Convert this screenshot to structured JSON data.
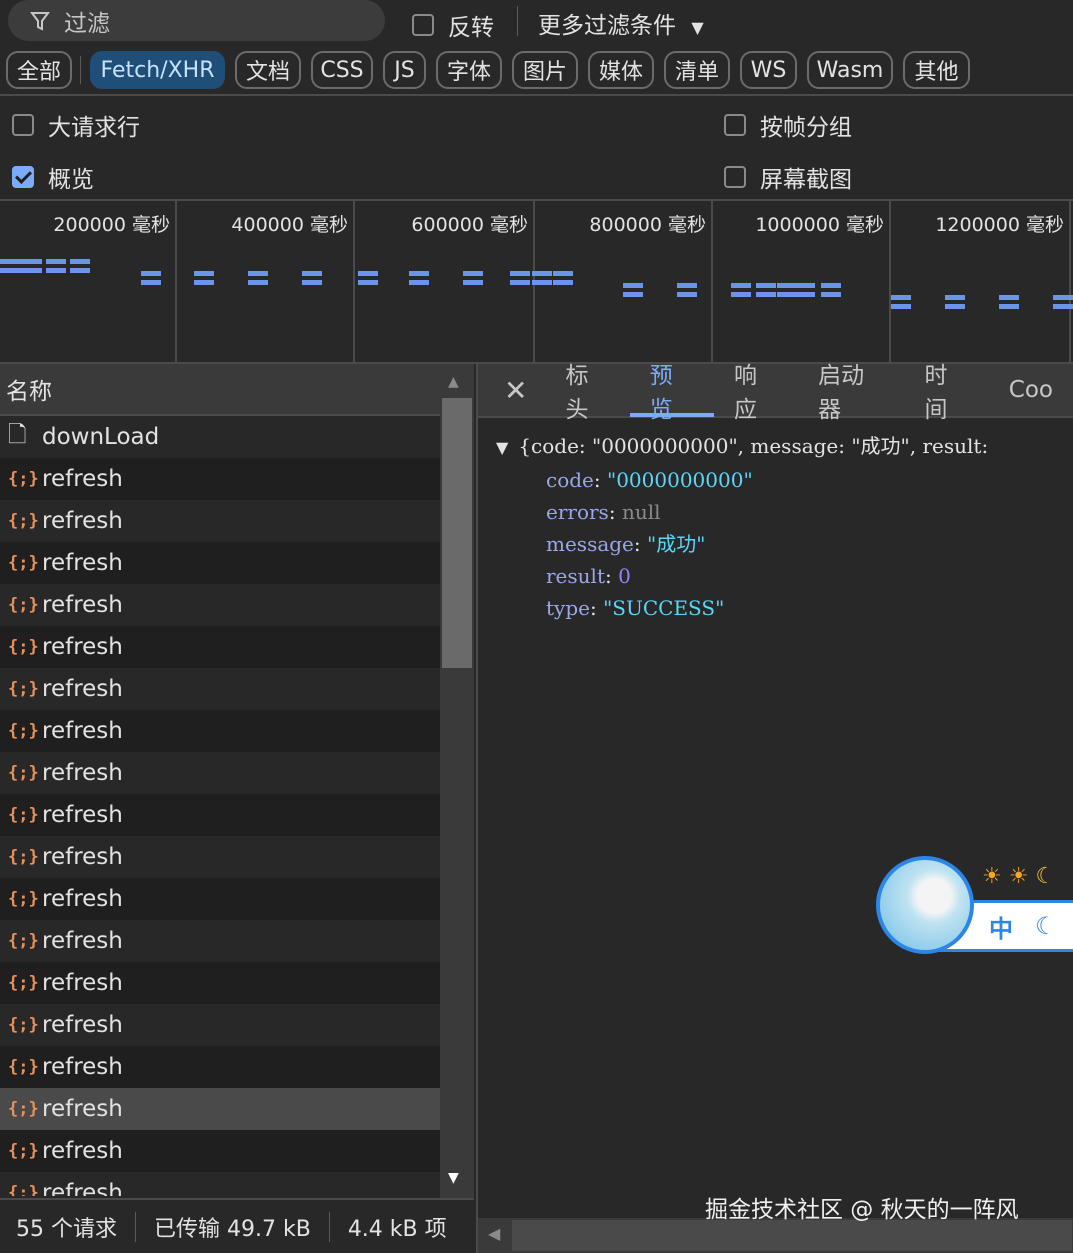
{
  "toolbar": {
    "filter_placeholder": "过滤",
    "invert_label": "反转",
    "more_filters": "更多过滤条件"
  },
  "chips": [
    {
      "label": "全部"
    },
    {
      "label": "Fetch/XHR",
      "active": true
    },
    {
      "label": "文档"
    },
    {
      "label": "CSS"
    },
    {
      "label": "JS"
    },
    {
      "label": "字体"
    },
    {
      "label": "图片"
    },
    {
      "label": "媒体"
    },
    {
      "label": "清单"
    },
    {
      "label": "WS"
    },
    {
      "label": "Wasm"
    },
    {
      "label": "其他"
    }
  ],
  "options": {
    "big_rows": {
      "label": "大请求行",
      "checked": false
    },
    "overview": {
      "label": "概览",
      "checked": true
    },
    "group_by_frame": {
      "label": "按帧分组",
      "checked": false
    },
    "screenshots": {
      "label": "屏幕截图",
      "checked": false
    }
  },
  "timeline": {
    "labels": [
      "200000 毫秒",
      "400000 毫秒",
      "600000 毫秒",
      "800000 毫秒",
      "1000000 毫秒",
      "1200000 毫秒"
    ],
    "bar_color": "#6b95e8"
  },
  "requests": {
    "header": "名称",
    "items": [
      "downLoad",
      "refresh",
      "refresh",
      "refresh",
      "refresh",
      "refresh",
      "refresh",
      "refresh",
      "refresh",
      "refresh",
      "refresh",
      "refresh",
      "refresh",
      "refresh",
      "refresh",
      "refresh",
      "refresh",
      "refresh",
      "refresh"
    ],
    "selected_index": 16
  },
  "status": {
    "requests": "55 个请求",
    "transferred": "已传输 49.7 kB",
    "resources": "4.4 kB 项"
  },
  "details": {
    "tabs": [
      "标头",
      "预览",
      "响应",
      "启动器",
      "时间",
      "Coo"
    ],
    "active_tab": "预览",
    "summary": "{code: \"0000000000\", message: \"成功\", result: ",
    "fields": [
      {
        "key": "code",
        "value": "\"0000000000\"",
        "kind": "str"
      },
      {
        "key": "errors",
        "value": "null",
        "kind": "null"
      },
      {
        "key": "message",
        "value": "\"成功\"",
        "kind": "str"
      },
      {
        "key": "result",
        "value": "0",
        "kind": "num"
      },
      {
        "key": "type",
        "value": "\"SUCCESS\"",
        "kind": "str"
      }
    ]
  },
  "widget": {
    "ime": "中"
  },
  "watermark": "掘金技术社区 @ 秋天的一阵风"
}
